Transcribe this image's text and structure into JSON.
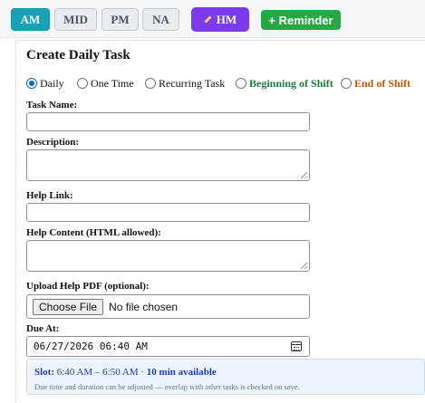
{
  "toolbar": {
    "shifts": [
      {
        "label": "AM",
        "active": true
      },
      {
        "label": "MID",
        "active": false
      },
      {
        "label": "PM",
        "active": false
      },
      {
        "label": "NA",
        "active": false
      }
    ],
    "hm_label": "HM",
    "reminder_label": "+ Reminder"
  },
  "form": {
    "title": "Create Daily Task",
    "task_types": [
      {
        "label": "Daily",
        "selected": true
      },
      {
        "label": "One Time",
        "selected": false
      },
      {
        "label": "Recurring Task",
        "selected": false
      },
      {
        "label": "Beginning of Shift",
        "selected": false
      },
      {
        "label": "End of Shift",
        "selected": false
      }
    ],
    "task_name_label": "Task Name:",
    "task_name_value": "",
    "description_label": "Description:",
    "description_value": "",
    "help_link_label": "Help Link:",
    "help_link_value": "",
    "help_content_label": "Help Content (HTML allowed):",
    "help_content_value": "",
    "upload_label": "Upload Help PDF (optional):",
    "choose_file_label": "Choose File",
    "no_file_text": "No file chosen",
    "due_label": "Due At:",
    "due_value": "06/27/2026 06:40 AM"
  },
  "slot": {
    "label": "Slot:",
    "range": "6:40 AM – 6:50 AM",
    "separator": "·",
    "available": "10 min available",
    "note": "Due time and duration can be adjusted — overlap with other tasks is checked on save."
  },
  "colors": {
    "active_shift": "#17a2b8",
    "hm": "#7c3aed",
    "reminder": "#28a745",
    "beginning_of_shift": "#1f7a3a",
    "end_of_shift": "#b65a0b",
    "slot_text": "#1e40af"
  },
  "icons": {
    "hm": "pencil-icon",
    "due": "calendar-icon"
  }
}
